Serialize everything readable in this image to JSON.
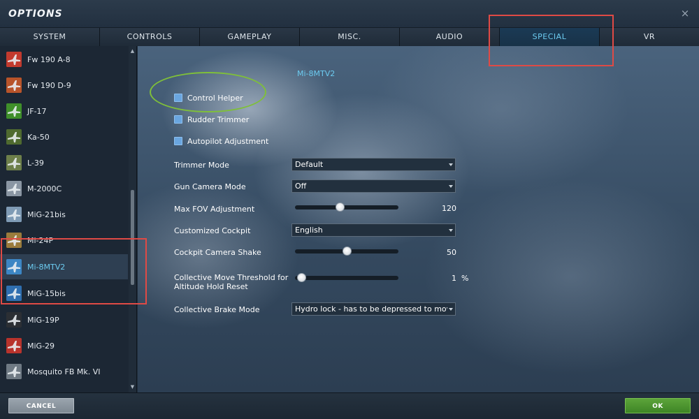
{
  "window": {
    "title": "OPTIONS",
    "close_glyph": "×"
  },
  "tabs": [
    {
      "label": "SYSTEM"
    },
    {
      "label": "CONTROLS"
    },
    {
      "label": "GAMEPLAY"
    },
    {
      "label": "MISC."
    },
    {
      "label": "AUDIO"
    },
    {
      "label": "SPECIAL",
      "active": true
    },
    {
      "label": "VR"
    }
  ],
  "sidebar": {
    "items": [
      {
        "label": "Fw 190 A-8",
        "icon": "fw190a8-aircraft-icon",
        "color": "#c23a2e"
      },
      {
        "label": "Fw 190 D-9",
        "icon": "fw190d9-dora-icon",
        "color": "#b8542a"
      },
      {
        "label": "JF-17",
        "icon": "jf17-aircraft-icon",
        "color": "#3f8f2a"
      },
      {
        "label": "Ka-50",
        "icon": "ka50-helicopter-icon",
        "color": "#4f6a2f"
      },
      {
        "label": "L-39",
        "icon": "l39-aircraft-icon",
        "color": "#6d7f4a"
      },
      {
        "label": "M-2000C",
        "icon": "m2000c-aircraft-icon",
        "color": "#8a96a3"
      },
      {
        "label": "MiG-21bis",
        "icon": "mig21-aircraft-icon",
        "color": "#7f9bb5"
      },
      {
        "label": "Mi-24P",
        "icon": "mi24p-helicopter-icon",
        "color": "#9a7b3c"
      },
      {
        "label": "Mi-8MTV2",
        "icon": "mi8-helicopter-icon",
        "color": "#3c86c4",
        "selected": true
      },
      {
        "label": "MiG-15bis",
        "icon": "mig15-aircraft-icon",
        "color": "#2f6fb0"
      },
      {
        "label": "MiG-19P",
        "icon": "mig19-aircraft-icon",
        "color": "#2b2f34"
      },
      {
        "label": "MiG-29",
        "icon": "mig29-aircraft-icon",
        "color": "#b8332c"
      },
      {
        "label": "Mosquito FB Mk. VI",
        "icon": "mosquito-aircraft-icon",
        "color": "#6f7a84"
      }
    ],
    "scroll_up_glyph": "▲",
    "scroll_down_glyph": "▼"
  },
  "main": {
    "section_title": "Mi-8MTV2",
    "checkboxes": [
      {
        "label": "Control Helper"
      },
      {
        "label": "Rudder Trimmer"
      },
      {
        "label": "Autopilot Adjustment"
      }
    ],
    "trimmer_mode": {
      "label": "Trimmer Mode",
      "value": "Default"
    },
    "gun_camera_mode": {
      "label": "Gun Camera Mode",
      "value": "Off"
    },
    "max_fov": {
      "label": "Max FOV Adjustment",
      "value": "120",
      "fraction": 0.43
    },
    "customized_cockpit": {
      "label": "Customized Cockpit",
      "value": "English"
    },
    "camera_shake": {
      "label": "Cockpit Camera Shake",
      "value": "50",
      "fraction": 0.5
    },
    "collective_threshold": {
      "label_line1": "Collective Move Threshold for",
      "label_line2": "Altitude Hold Reset",
      "value": "1",
      "unit": "%",
      "fraction": 0.02
    },
    "collective_brake": {
      "label": "Collective Brake Mode",
      "value": "Hydro lock - has to be depressed to move collective"
    }
  },
  "footer": {
    "cancel_label": "CANCEL",
    "ok_label": "OK"
  },
  "colors": {
    "accent": "#6ccbf0",
    "annotation_red": "#e04a45",
    "annotation_green": "#7fbf3a",
    "ok_green": "#4e9a30"
  }
}
